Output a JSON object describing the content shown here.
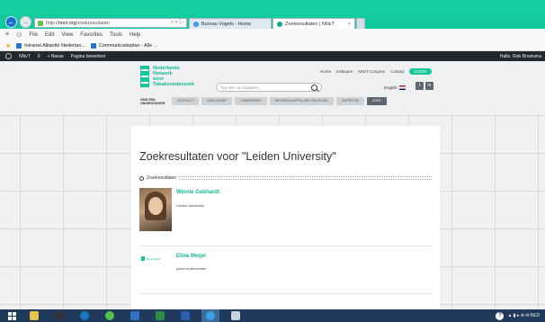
{
  "browser": {
    "address_prefix": "http://",
    "address_host": "nnvt.org",
    "address_path": "/zoekresultaten",
    "address_tools": "⌕ ▾ ↻",
    "tabs": [
      {
        "label": "Bureau Vogels - Home"
      },
      {
        "label": "Zoekresultaten | NNvT",
        "close": "×"
      }
    ],
    "menu": [
      "File",
      "Edit",
      "View",
      "Favorites",
      "Tools",
      "Help"
    ],
    "bookmarks": [
      "Intranet Alliantië Nederlan...",
      "Communicatieplan - Alle ..."
    ],
    "wpbar": {
      "site": "NNvT",
      "comments": "0",
      "new": "+ Nieuw",
      "edit": "Pagina bewerken",
      "greeting": "Hallo, Rob Broekstra"
    }
  },
  "site": {
    "logo_lines": [
      "Nederlands",
      "Network",
      "voor",
      "Tabaksonderzoek"
    ],
    "topnav": [
      "Home",
      "Instituten",
      "NNvT Congres",
      "Contact"
    ],
    "login": "LOGIN",
    "search_placeholder": "Typ hier uw zoekterm...",
    "language": "English",
    "mainnav_label": "VIND EEN ONDERZOEKER",
    "mainnav": [
      "INSTITUUT",
      "DOELGROEP",
      "ONDERWERP",
      "WETENSCHAPPELIJKE DISCIPLINE",
      "EXPERTISE"
    ],
    "mainnav_button": "ZOEK"
  },
  "results": {
    "title": "Zoekresultaten voor \"Leiden University\"",
    "bar_label": "Zoekresultaten",
    "items": [
      {
        "name": "Winnie Gebhardt",
        "org": "Leiden University"
      },
      {
        "name": "Eline Meijer",
        "org": "junior-onderzoeker",
        "logo_text": "Nederlands"
      }
    ]
  },
  "taskbar": {
    "tray_text": "▲ ▮ ▸ ⊘ ✉ NLD"
  },
  "colors": {
    "accent": "#14c79a",
    "taskbar": "#1f3a5a"
  }
}
